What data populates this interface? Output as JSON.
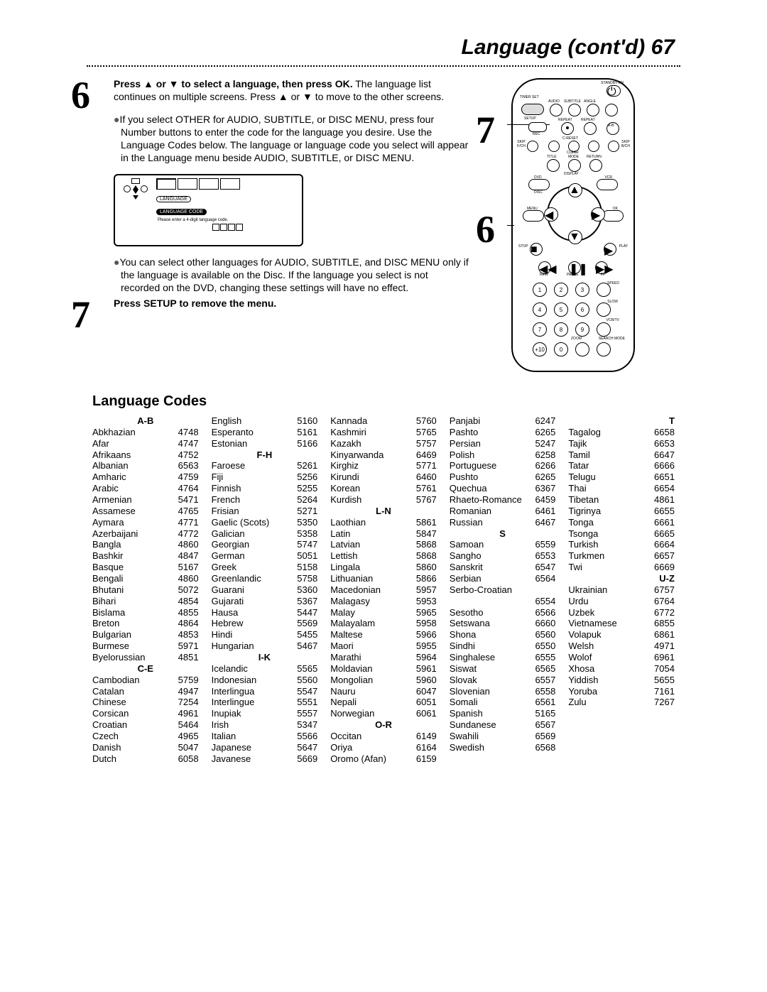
{
  "page_title": "Language (cont'd)",
  "page_number": "67",
  "step6_title": "Press ▲ or ▼ to select a language, then press OK.",
  "step6_body": " The language list continues on multiple screens. Press ▲ or ▼ to move to the other screens.",
  "step6_bullet1": "If you select OTHER for AUDIO, SUBTITLE, or DISC MENU, press four Number buttons to enter the code for the language you desire. Use the Language Codes below. The language or language code you select will appear in the Language menu beside AUDIO, SUBTITLE, or DISC MENU.",
  "step6_dialog_label": "LANGUAGE",
  "step6_dialog_code": "LANGUAGE CODE",
  "step6_dialog_msg": "Please enter a 4-digit language code.",
  "step6_bullet2": "You can select other languages for AUDIO, SUBTITLE, and DISC MENU only if the language is available on the Disc. If the language you select is not recorded on the DVD, changing these settings will have no effect.",
  "step7": "Press SETUP to remove the menu.",
  "remote": {
    "standby": "STANDBY-ON",
    "timer": "TIMER SET",
    "setup": "SETUP",
    "audio": "AUDIO",
    "subtitle": "SUBTITLE",
    "angle": "ANGLE",
    "rec": "REC",
    "repeat1": "REPEAT",
    "repeat2": "REPEAT",
    "ab": "A-B",
    "skipl": "SKIP\nF/CH",
    "creset": "C-RESET",
    "clear": "CLEAR",
    "skipr": "SKIP\nB/CH",
    "title": "TITLE",
    "mode": "MODE",
    "return": "RETURN",
    "display": "DISPLAY",
    "dvd": "DVD",
    "vcr": "VCR",
    "disc": "DISC",
    "menu": "MENU",
    "ok": "OK",
    "stop": "STOP",
    "play": "PLAY",
    "rew": "REW",
    "pause": "PAUSE",
    "ff": "FF",
    "speed": "SPEED",
    "slow": "SLOW",
    "vcrtv": "VCR/TV",
    "zoom": "ZOOM",
    "search": "SEARCH MODE"
  },
  "codes_heading": "Language Codes",
  "cols": [
    [
      {
        "h": "A-B"
      },
      {
        "n": "Abkhazian",
        "c": "4748"
      },
      {
        "n": "Afar",
        "c": "4747"
      },
      {
        "n": "Afrikaans",
        "c": "4752"
      },
      {
        "n": "Albanian",
        "c": "6563"
      },
      {
        "n": "Amharic",
        "c": "4759"
      },
      {
        "n": "Arabic",
        "c": "4764"
      },
      {
        "n": "Armenian",
        "c": "5471"
      },
      {
        "n": "Assamese",
        "c": "4765"
      },
      {
        "n": "Aymara",
        "c": "4771"
      },
      {
        "n": "Azerbaijani",
        "c": "4772"
      },
      {
        "n": "Bangla",
        "c": "4860"
      },
      {
        "n": "Bashkir",
        "c": "4847"
      },
      {
        "n": "Basque",
        "c": "5167"
      },
      {
        "n": "Bengali",
        "c": "4860"
      },
      {
        "n": "Bhutani",
        "c": "5072"
      },
      {
        "n": "Bihari",
        "c": "4854"
      },
      {
        "n": "Bislama",
        "c": "4855"
      },
      {
        "n": "Breton",
        "c": "4864"
      },
      {
        "n": "Bulgarian",
        "c": "4853"
      },
      {
        "n": "Burmese",
        "c": "5971"
      },
      {
        "n": "Byelorussian",
        "c": "4851"
      },
      {
        "h": "C-E"
      },
      {
        "n": "Cambodian",
        "c": "5759"
      },
      {
        "n": "Catalan",
        "c": "4947"
      },
      {
        "n": "Chinese",
        "c": "7254"
      },
      {
        "n": "Corsican",
        "c": "4961"
      },
      {
        "n": "Croatian",
        "c": "5464"
      },
      {
        "n": "Czech",
        "c": "4965"
      },
      {
        "n": "Danish",
        "c": "5047"
      },
      {
        "n": "Dutch",
        "c": "6058"
      }
    ],
    [
      {
        "n": "English",
        "c": "5160"
      },
      {
        "n": "Esperanto",
        "c": "5161"
      },
      {
        "n": "Estonian",
        "c": "5166"
      },
      {
        "h": "F-H"
      },
      {
        "n": "Faroese",
        "c": "5261"
      },
      {
        "n": "Fiji",
        "c": "5256"
      },
      {
        "n": "Finnish",
        "c": "5255"
      },
      {
        "n": "French",
        "c": "5264"
      },
      {
        "n": "Frisian",
        "c": "5271"
      },
      {
        "n": "Gaelic (Scots)",
        "c": "5350"
      },
      {
        "n": "Galician",
        "c": "5358"
      },
      {
        "n": "Georgian",
        "c": "5747"
      },
      {
        "n": "German",
        "c": "5051"
      },
      {
        "n": "Greek",
        "c": "5158"
      },
      {
        "n": "Greenlandic",
        "c": "5758"
      },
      {
        "n": "Guarani",
        "c": "5360"
      },
      {
        "n": "Gujarati",
        "c": "5367"
      },
      {
        "n": "Hausa",
        "c": "5447"
      },
      {
        "n": "Hebrew",
        "c": "5569"
      },
      {
        "n": "Hindi",
        "c": "5455"
      },
      {
        "n": "Hungarian",
        "c": "5467"
      },
      {
        "h": "I-K"
      },
      {
        "n": "Icelandic",
        "c": "5565"
      },
      {
        "n": "Indonesian",
        "c": "5560"
      },
      {
        "n": "Interlingua",
        "c": "5547"
      },
      {
        "n": "Interlingue",
        "c": "5551"
      },
      {
        "n": "Inupiak",
        "c": "5557"
      },
      {
        "n": "Irish",
        "c": "5347"
      },
      {
        "n": "Italian",
        "c": "5566"
      },
      {
        "n": "Japanese",
        "c": "5647"
      },
      {
        "n": "Javanese",
        "c": "5669"
      }
    ],
    [
      {
        "n": "Kannada",
        "c": "5760"
      },
      {
        "n": "Kashmiri",
        "c": "5765"
      },
      {
        "n": "Kazakh",
        "c": "5757"
      },
      {
        "n": "Kinyarwanda",
        "c": "6469"
      },
      {
        "n": "Kirghiz",
        "c": "5771"
      },
      {
        "n": "Kirundi",
        "c": "6460"
      },
      {
        "n": "Korean",
        "c": "5761"
      },
      {
        "n": "Kurdish",
        "c": "5767"
      },
      {
        "h": "L-N"
      },
      {
        "n": "Laothian",
        "c": "5861"
      },
      {
        "n": "Latin",
        "c": "5847"
      },
      {
        "n": "Latvian",
        "c": "5868"
      },
      {
        "n": "Lettish",
        "c": "5868"
      },
      {
        "n": "Lingala",
        "c": "5860"
      },
      {
        "n": "Lithuanian",
        "c": "5866"
      },
      {
        "n": "Macedonian",
        "c": "5957"
      },
      {
        "n": "Malagasy",
        "c": "5953"
      },
      {
        "n": "Malay",
        "c": "5965"
      },
      {
        "n": "Malayalam",
        "c": "5958"
      },
      {
        "n": "Maltese",
        "c": "5966"
      },
      {
        "n": "Maori",
        "c": "5955"
      },
      {
        "n": "Marathi",
        "c": "5964"
      },
      {
        "n": "Moldavian",
        "c": "5961"
      },
      {
        "n": "Mongolian",
        "c": "5960"
      },
      {
        "n": "Nauru",
        "c": "6047"
      },
      {
        "n": "Nepali",
        "c": "6051"
      },
      {
        "n": "Norwegian",
        "c": "6061"
      },
      {
        "h": "O-R"
      },
      {
        "n": "Occitan",
        "c": "6149"
      },
      {
        "n": "Oriya",
        "c": "6164"
      },
      {
        "n": "Oromo (Afan)",
        "c": "6159"
      }
    ],
    [
      {
        "n": "Panjabi",
        "c": "6247"
      },
      {
        "n": "Pashto",
        "c": "6265"
      },
      {
        "n": "Persian",
        "c": "5247"
      },
      {
        "n": "Polish",
        "c": "6258"
      },
      {
        "n": "Portuguese",
        "c": "6266"
      },
      {
        "n": "Pushto",
        "c": "6265"
      },
      {
        "n": "Quechua",
        "c": "6367"
      },
      {
        "n": "Rhaeto-Romance",
        "c": "6459"
      },
      {
        "n": "Romanian",
        "c": "6461"
      },
      {
        "n": "Russian",
        "c": "6467"
      },
      {
        "h": "S"
      },
      {
        "n": "Samoan",
        "c": "6559"
      },
      {
        "n": "Sangho",
        "c": "6553"
      },
      {
        "n": "Sanskrit",
        "c": "6547"
      },
      {
        "n": "Serbian",
        "c": "6564"
      },
      {
        "n": "Serbo-Croatian",
        "c": ""
      },
      {
        "n": "",
        "c": "6554"
      },
      {
        "n": "Sesotho",
        "c": "6566"
      },
      {
        "n": "Setswana",
        "c": "6660"
      },
      {
        "n": "Shona",
        "c": "6560"
      },
      {
        "n": "Sindhi",
        "c": "6550"
      },
      {
        "n": "Singhalese",
        "c": "6555"
      },
      {
        "n": "Siswat",
        "c": "6565"
      },
      {
        "n": "Slovak",
        "c": "6557"
      },
      {
        "n": "Slovenian",
        "c": "6558"
      },
      {
        "n": "Somali",
        "c": "6561"
      },
      {
        "n": "Spanish",
        "c": "5165"
      },
      {
        "n": "Sundanese",
        "c": "6567"
      },
      {
        "n": "Swahili",
        "c": "6569"
      },
      {
        "n": "Swedish",
        "c": "6568"
      }
    ],
    [
      {
        "hr": "T"
      },
      {
        "n": "Tagalog",
        "c": "6658"
      },
      {
        "n": "Tajik",
        "c": "6653"
      },
      {
        "n": "Tamil",
        "c": "6647"
      },
      {
        "n": "Tatar",
        "c": "6666"
      },
      {
        "n": "Telugu",
        "c": "6651"
      },
      {
        "n": "Thai",
        "c": "6654"
      },
      {
        "n": "Tibetan",
        "c": "4861"
      },
      {
        "n": "Tigrinya",
        "c": "6655"
      },
      {
        "n": "Tonga",
        "c": "6661"
      },
      {
        "n": "Tsonga",
        "c": "6665"
      },
      {
        "n": "Turkish",
        "c": "6664"
      },
      {
        "n": "Turkmen",
        "c": "6657"
      },
      {
        "n": "Twi",
        "c": "6669"
      },
      {
        "hr": "U-Z"
      },
      {
        "n": "Ukrainian",
        "c": "6757"
      },
      {
        "n": "Urdu",
        "c": "6764"
      },
      {
        "n": "Uzbek",
        "c": "6772"
      },
      {
        "n": "Vietnamese",
        "c": "6855"
      },
      {
        "n": "Volapuk",
        "c": "6861"
      },
      {
        "n": "Welsh",
        "c": "4971"
      },
      {
        "n": "Wolof",
        "c": "6961"
      },
      {
        "n": "Xhosa",
        "c": "7054"
      },
      {
        "n": "Yiddish",
        "c": "5655"
      },
      {
        "n": "Yoruba",
        "c": "7161"
      },
      {
        "n": "Zulu",
        "c": "7267"
      }
    ]
  ]
}
